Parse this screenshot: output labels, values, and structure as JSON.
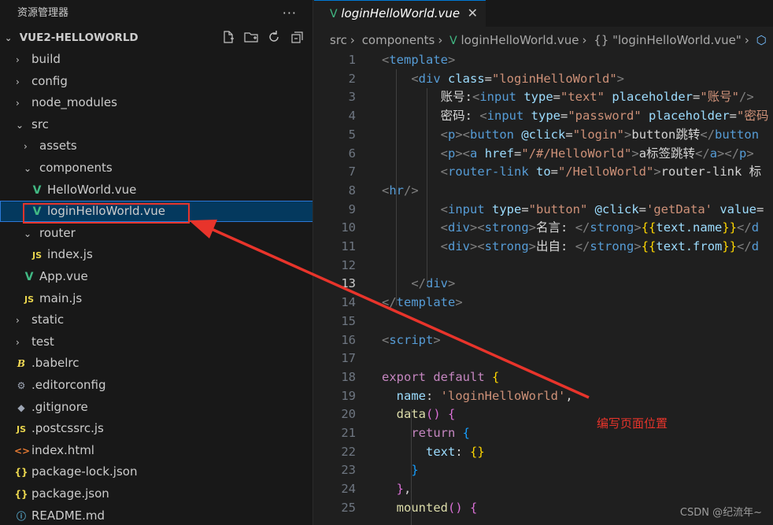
{
  "explorer": {
    "title": "资源管理器",
    "more": "···",
    "project": "VUE2-HELLOWORLD",
    "actions": [
      "new-file-icon",
      "new-folder-icon",
      "refresh-icon",
      "collapse-all-icon"
    ],
    "items": [
      {
        "label": "build",
        "type": "folder",
        "open": false,
        "depth": 0
      },
      {
        "label": "config",
        "type": "folder",
        "open": false,
        "depth": 0
      },
      {
        "label": "node_modules",
        "type": "folder",
        "open": false,
        "depth": 0
      },
      {
        "label": "src",
        "type": "folder",
        "open": true,
        "depth": 0
      },
      {
        "label": "assets",
        "type": "folder",
        "open": false,
        "depth": 1
      },
      {
        "label": "components",
        "type": "folder",
        "open": true,
        "depth": 1
      },
      {
        "label": "HelloWorld.vue",
        "type": "vue",
        "depth": 2
      },
      {
        "label": "loginHelloWorld.vue",
        "type": "vue",
        "depth": 2,
        "selected": true
      },
      {
        "label": "router",
        "type": "folder",
        "open": true,
        "depth": 1
      },
      {
        "label": "index.js",
        "type": "js",
        "depth": 2
      },
      {
        "label": "App.vue",
        "type": "vue",
        "depth": 1
      },
      {
        "label": "main.js",
        "type": "js",
        "depth": 1
      },
      {
        "label": "static",
        "type": "folder",
        "open": false,
        "depth": 0
      },
      {
        "label": "test",
        "type": "folder",
        "open": false,
        "depth": 0
      },
      {
        "label": ".babelrc",
        "type": "babel",
        "depth": 0
      },
      {
        "label": ".editorconfig",
        "type": "gear",
        "depth": 0
      },
      {
        "label": ".gitignore",
        "type": "git",
        "depth": 0
      },
      {
        "label": ".postcssrc.js",
        "type": "js",
        "depth": 0
      },
      {
        "label": "index.html",
        "type": "html",
        "depth": 0
      },
      {
        "label": "package-lock.json",
        "type": "json",
        "depth": 0
      },
      {
        "label": "package.json",
        "type": "json",
        "depth": 0
      },
      {
        "label": "README.md",
        "type": "info",
        "depth": 0
      }
    ]
  },
  "tab": {
    "label": "loginHelloWorld.vue",
    "close": "✕"
  },
  "breadcrumb": [
    "src",
    "components",
    "loginHelloWorld.vue",
    "{} \"loginHelloWorld.vue\""
  ],
  "editor": {
    "current_line": 13,
    "lines": [
      [
        [
          "t-br",
          "<"
        ],
        [
          "t-tag",
          "template"
        ],
        [
          "t-br",
          ">"
        ]
      ],
      [
        [
          "",
          "    "
        ],
        [
          "t-br",
          "<"
        ],
        [
          "t-tag",
          "div "
        ],
        [
          "t-attr",
          "class"
        ],
        [
          "t-txt",
          "="
        ],
        [
          "t-str",
          "\"loginHelloWorld\""
        ],
        [
          "t-br",
          ">"
        ]
      ],
      [
        [
          "",
          "        "
        ],
        [
          "t-txt",
          "账号:"
        ],
        [
          "t-br",
          "<"
        ],
        [
          "t-tag",
          "input "
        ],
        [
          "t-attr",
          "type"
        ],
        [
          "t-txt",
          "="
        ],
        [
          "t-str",
          "\"text\" "
        ],
        [
          "t-attr",
          "placeholder"
        ],
        [
          "t-txt",
          "="
        ],
        [
          "t-str",
          "\"账号\""
        ],
        [
          "t-br",
          "/>"
        ]
      ],
      [
        [
          "",
          "        "
        ],
        [
          "t-txt",
          "密码: "
        ],
        [
          "t-br",
          "<"
        ],
        [
          "t-tag",
          "input "
        ],
        [
          "t-attr",
          "type"
        ],
        [
          "t-txt",
          "="
        ],
        [
          "t-str",
          "\"password\" "
        ],
        [
          "t-attr",
          "placeholder"
        ],
        [
          "t-txt",
          "="
        ],
        [
          "t-str",
          "\"密码"
        ]
      ],
      [
        [
          "",
          "        "
        ],
        [
          "t-br",
          "<"
        ],
        [
          "t-tag",
          "p"
        ],
        [
          "t-br",
          "><"
        ],
        [
          "t-tag",
          "button "
        ],
        [
          "t-attr",
          "@click"
        ],
        [
          "t-txt",
          "="
        ],
        [
          "t-str",
          "\"login\""
        ],
        [
          "t-br",
          ">"
        ],
        [
          "t-txt",
          "button跳转"
        ],
        [
          "t-br",
          "</"
        ],
        [
          "t-tag",
          "button"
        ]
      ],
      [
        [
          "",
          "        "
        ],
        [
          "t-br",
          "<"
        ],
        [
          "t-tag",
          "p"
        ],
        [
          "t-br",
          "><"
        ],
        [
          "t-tag",
          "a "
        ],
        [
          "t-attr",
          "href"
        ],
        [
          "t-txt",
          "="
        ],
        [
          "t-str",
          "\"/#/HelloWorld\""
        ],
        [
          "t-br",
          ">"
        ],
        [
          "t-txt",
          "a标签跳转"
        ],
        [
          "t-br",
          "</"
        ],
        [
          "t-tag",
          "a"
        ],
        [
          "t-br",
          "></"
        ],
        [
          "t-tag",
          "p"
        ],
        [
          "t-br",
          ">"
        ]
      ],
      [
        [
          "",
          "        "
        ],
        [
          "t-br",
          "<"
        ],
        [
          "t-tag",
          "router-link "
        ],
        [
          "t-attr",
          "to"
        ],
        [
          "t-txt",
          "="
        ],
        [
          "t-str",
          "\"/HelloWorld\""
        ],
        [
          "t-br",
          ">"
        ],
        [
          "t-txt",
          "router-link 标"
        ]
      ],
      [
        [
          "t-br",
          "<"
        ],
        [
          "t-tag",
          "hr"
        ],
        [
          "t-br",
          "/>"
        ]
      ],
      [
        [
          "",
          "        "
        ],
        [
          "t-br",
          "<"
        ],
        [
          "t-tag",
          "input "
        ],
        [
          "t-attr",
          "type"
        ],
        [
          "t-txt",
          "="
        ],
        [
          "t-str",
          "\"button\" "
        ],
        [
          "t-attr",
          "@click"
        ],
        [
          "t-txt",
          "="
        ],
        [
          "t-str",
          "'getData' "
        ],
        [
          "t-attr",
          "value"
        ],
        [
          "t-txt",
          "="
        ]
      ],
      [
        [
          "",
          "        "
        ],
        [
          "t-br",
          "<"
        ],
        [
          "t-tag",
          "div"
        ],
        [
          "t-br",
          "><"
        ],
        [
          "t-tag",
          "strong"
        ],
        [
          "t-br",
          ">"
        ],
        [
          "t-txt",
          "名言: "
        ],
        [
          "t-br",
          "</"
        ],
        [
          "t-tag",
          "strong"
        ],
        [
          "t-br",
          ">"
        ],
        [
          "t-y",
          "{{"
        ],
        [
          "t-var",
          "text.name"
        ],
        [
          "t-y",
          "}}"
        ],
        [
          "t-br",
          "</"
        ],
        [
          "t-tag",
          "d"
        ]
      ],
      [
        [
          "",
          "        "
        ],
        [
          "t-br",
          "<"
        ],
        [
          "t-tag",
          "div"
        ],
        [
          "t-br",
          "><"
        ],
        [
          "t-tag",
          "strong"
        ],
        [
          "t-br",
          ">"
        ],
        [
          "t-txt",
          "出自: "
        ],
        [
          "t-br",
          "</"
        ],
        [
          "t-tag",
          "strong"
        ],
        [
          "t-br",
          ">"
        ],
        [
          "t-y",
          "{{"
        ],
        [
          "t-var",
          "text.from"
        ],
        [
          "t-y",
          "}}"
        ],
        [
          "t-br",
          "</"
        ],
        [
          "t-tag",
          "d"
        ]
      ],
      [
        [
          "",
          ""
        ]
      ],
      [
        [
          "",
          "    "
        ],
        [
          "t-br",
          "</"
        ],
        [
          "t-tag",
          "div"
        ],
        [
          "t-br",
          ">"
        ]
      ],
      [
        [
          "t-br",
          "</"
        ],
        [
          "t-tag",
          "template"
        ],
        [
          "t-br",
          ">"
        ]
      ],
      [
        [
          "",
          ""
        ]
      ],
      [
        [
          "t-br",
          "<"
        ],
        [
          "t-tag",
          "script"
        ],
        [
          "t-br",
          ">"
        ]
      ],
      [
        [
          "",
          ""
        ]
      ],
      [
        [
          "t-kw",
          "export default "
        ],
        [
          "t-y",
          "{"
        ]
      ],
      [
        [
          "",
          "  "
        ],
        [
          "t-var",
          "name"
        ],
        [
          "t-txt",
          ": "
        ],
        [
          "t-str",
          "'loginHelloWorld'"
        ],
        [
          "t-txt",
          ","
        ]
      ],
      [
        [
          "",
          "  "
        ],
        [
          "t-fn",
          "data"
        ],
        [
          "t-p",
          "()"
        ],
        [
          "t-txt",
          " "
        ],
        [
          "t-p",
          "{"
        ]
      ],
      [
        [
          "",
          "    "
        ],
        [
          "t-kw",
          "return "
        ],
        [
          "t-bl",
          "{"
        ]
      ],
      [
        [
          "",
          "      "
        ],
        [
          "t-var",
          "text"
        ],
        [
          "t-txt",
          ": "
        ],
        [
          "t-y",
          "{}"
        ]
      ],
      [
        [
          "",
          "    "
        ],
        [
          "t-bl",
          "}"
        ]
      ],
      [
        [
          "",
          "  "
        ],
        [
          "t-p",
          "}"
        ],
        [
          "t-txt",
          ","
        ]
      ],
      [
        [
          "",
          "  "
        ],
        [
          "t-fn",
          "mounted"
        ],
        [
          "t-p",
          "()"
        ],
        [
          "t-txt",
          " "
        ],
        [
          "t-p",
          "{"
        ]
      ]
    ]
  },
  "annotation": "编写页面位置",
  "watermark": "CSDN @纪流年~"
}
